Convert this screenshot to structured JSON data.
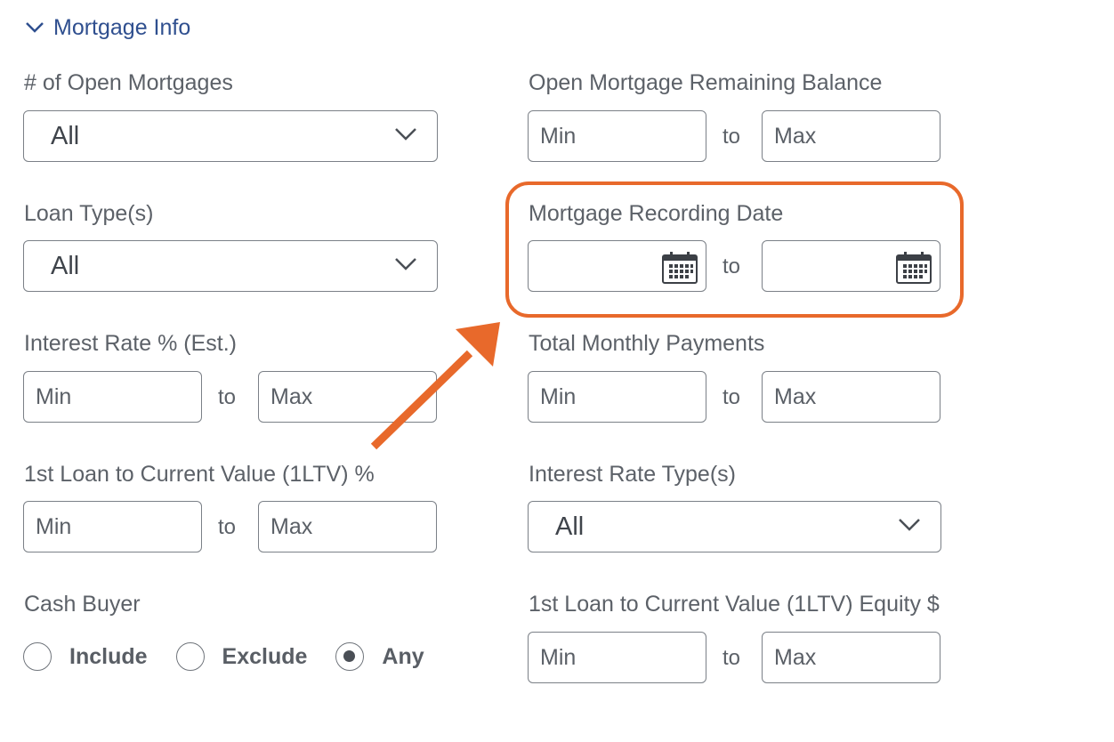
{
  "section": {
    "title": "Mortgage Info",
    "icon": "chevron-down-icon"
  },
  "fields": {
    "open_mortgages": {
      "label": "# of Open Mortgages",
      "value": "All"
    },
    "remaining_balance": {
      "label": "Open Mortgage Remaining Balance",
      "min_placeholder": "Min",
      "to": "to",
      "max_placeholder": "Max"
    },
    "loan_types": {
      "label": "Loan Type(s)",
      "value": "All"
    },
    "recording_date": {
      "label": "Mortgage Recording Date",
      "to": "to",
      "icon": "calendar-icon"
    },
    "interest_rate": {
      "label": "Interest Rate % (Est.)",
      "min_placeholder": "Min",
      "to": "to",
      "max_placeholder": "Max"
    },
    "monthly_payments": {
      "label": "Total Monthly Payments",
      "min_placeholder": "Min",
      "to": "to",
      "max_placeholder": "Max"
    },
    "ltv": {
      "label": "1st Loan to Current Value (1LTV) %",
      "min_placeholder": "Min",
      "to": "to",
      "max_placeholder": "Max"
    },
    "rate_types": {
      "label": "Interest Rate Type(s)",
      "value": "All"
    },
    "cash_buyer": {
      "label": "Cash Buyer",
      "options": [
        {
          "label": "Include",
          "selected": false
        },
        {
          "label": "Exclude",
          "selected": false
        },
        {
          "label": "Any",
          "selected": true
        }
      ]
    },
    "ltv_equity": {
      "label": "1st Loan to Current Value (1LTV) Equity $",
      "min_placeholder": "Min",
      "to": "to",
      "max_placeholder": "Max"
    }
  },
  "annotation": {
    "color": "#e8692b"
  },
  "colors": {
    "section_title": "#2f4f8f",
    "border": "#7b8087"
  }
}
